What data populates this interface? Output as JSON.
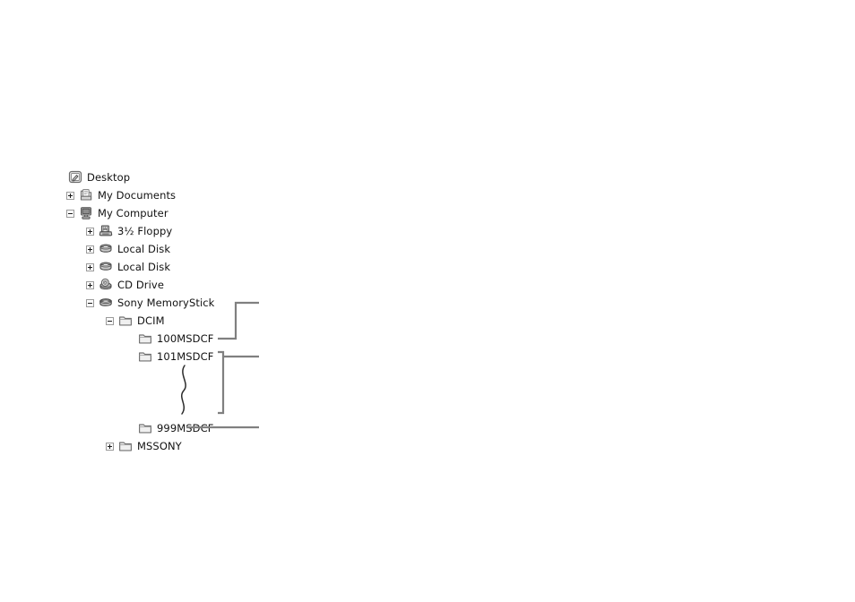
{
  "figure": {
    "type": "folder-tree-diagram",
    "background_color": "#ffffff",
    "line_color": "#808080",
    "text_color": "#111111"
  },
  "tree": {
    "nodes": [
      {
        "label": "Desktop",
        "level": 0,
        "icon": "desktop-icon",
        "expander": "none"
      },
      {
        "label": "My Documents",
        "level": 1,
        "icon": "my-documents-icon",
        "expander": "plus"
      },
      {
        "label": "My Computer",
        "level": 1,
        "icon": "my-computer-icon",
        "expander": "minus"
      },
      {
        "label": "3½ Floppy",
        "level": 2,
        "icon": "floppy-drive-icon",
        "expander": "plus"
      },
      {
        "label": "Local Disk",
        "level": 2,
        "icon": "hard-disk-icon",
        "expander": "plus"
      },
      {
        "label": "Local Disk",
        "level": 2,
        "icon": "hard-disk-icon",
        "expander": "plus"
      },
      {
        "label": "CD Drive",
        "level": 2,
        "icon": "cd-drive-icon",
        "expander": "plus"
      },
      {
        "label": "Sony MemoryStick",
        "level": 2,
        "icon": "memorystick-drive-icon",
        "expander": "minus"
      },
      {
        "label": "DCIM",
        "level": 3,
        "icon": "folder-icon",
        "expander": "minus"
      },
      {
        "label": "100MSDCF",
        "level": 4,
        "icon": "folder-icon",
        "expander": "none"
      },
      {
        "label": "101MSDCF",
        "level": 4,
        "icon": "folder-icon",
        "expander": "none"
      },
      {
        "label": "999MSDCF",
        "level": 4,
        "icon": "folder-icon",
        "expander": "none"
      },
      {
        "label": "MSSONY",
        "level": 3,
        "icon": "folder-icon",
        "expander": "plus"
      }
    ],
    "ellipsis_mark": "vertical-squiggle"
  },
  "leaders": {
    "items": [
      {
        "name": "leader-100msdcf",
        "shape": "bracket-up-right"
      },
      {
        "name": "leader-msdcf-range",
        "shape": "bracket-span-right"
      },
      {
        "name": "leader-mssony",
        "shape": "straight-right"
      }
    ]
  }
}
